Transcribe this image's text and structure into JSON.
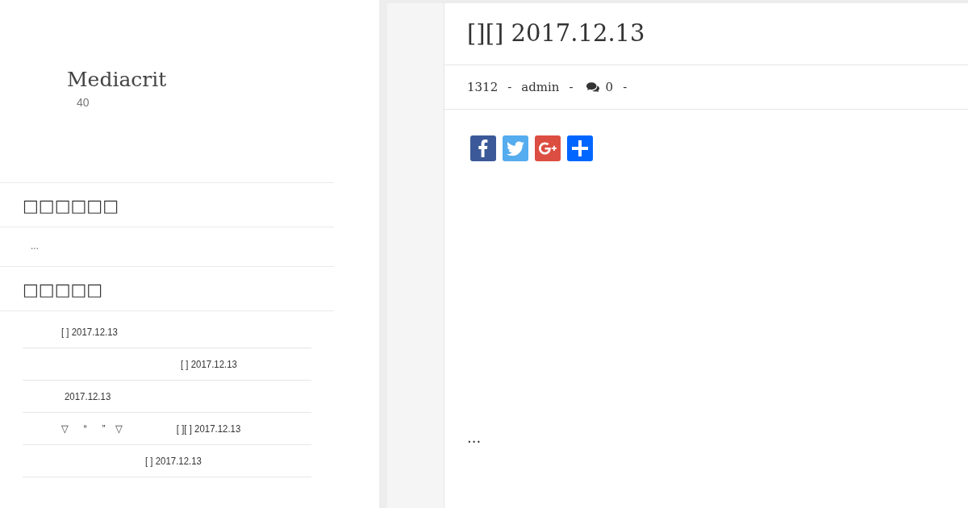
{
  "site": {
    "title": "Mediacrit",
    "subtitle": "40"
  },
  "widgets": [
    {
      "kind": "text",
      "heading": "□□□□□□",
      "body": "..."
    },
    {
      "kind": "list",
      "heading": "□□□□□",
      "items": [
        "[ ] 2017.12.13",
        "[ ] 2017.12.13",
        "2017.12.13",
        "▽      “      ”    ▽                     [ ][ ] 2017.12.13",
        "[ ] 2017.12.13"
      ]
    }
  ],
  "post": {
    "title": "[][] 2017.12.13",
    "meta": [
      "1312",
      "-",
      "admin",
      "-",
      "0",
      "-"
    ],
    "share": [
      {
        "kind": "facebook"
      },
      {
        "kind": "twitter"
      },
      {
        "kind": "googleplus"
      },
      {
        "kind": "share"
      }
    ],
    "excerpt": "..."
  }
}
